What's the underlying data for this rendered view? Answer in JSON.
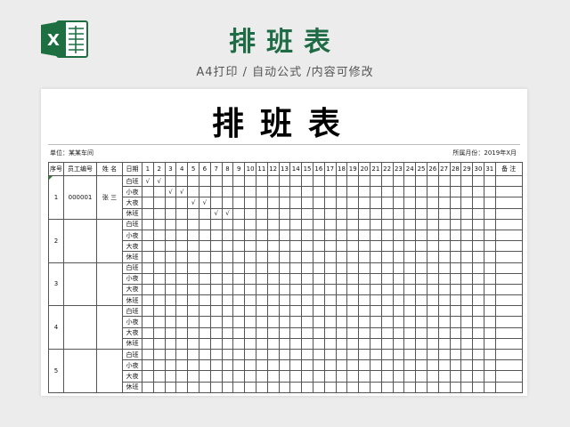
{
  "banner": {
    "title": "排班表",
    "subtitle": "A4打印 / 自动公式 /内容可修改",
    "logo_letter": "X",
    "colors": {
      "excel_green": "#1d6f42",
      "title_green": "#1e6b45"
    }
  },
  "sheet": {
    "title": "排班表",
    "unit_label": "单位：某某车间",
    "month_label": "所属月份：2019年X月",
    "headers": {
      "seq": "序号",
      "emp_id": "员工编号",
      "name": "姓 名",
      "date": "日期",
      "days": [
        "1",
        "2",
        "3",
        "4",
        "5",
        "6",
        "7",
        "8",
        "9",
        "10",
        "11",
        "12",
        "13",
        "14",
        "15",
        "16",
        "17",
        "18",
        "19",
        "20",
        "21",
        "22",
        "23",
        "24",
        "25",
        "26",
        "27",
        "28",
        "29",
        "30",
        "31"
      ],
      "remark": "备 注"
    },
    "shift_types": [
      "白班",
      "小夜",
      "大夜",
      "休班"
    ],
    "check_mark": "√",
    "rows": [
      {
        "seq": "1",
        "emp_id": "000001",
        "name": "张 三",
        "marks": [
          [
            1,
            2
          ],
          [
            3,
            4
          ],
          [
            5,
            6
          ],
          [
            7,
            8
          ]
        ]
      },
      {
        "seq": "2",
        "emp_id": "",
        "name": "",
        "marks": [
          [],
          [],
          [],
          []
        ]
      },
      {
        "seq": "3",
        "emp_id": "",
        "name": "",
        "marks": [
          [],
          [],
          [],
          []
        ]
      },
      {
        "seq": "4",
        "emp_id": "",
        "name": "",
        "marks": [
          [],
          [],
          [],
          []
        ]
      },
      {
        "seq": "5",
        "emp_id": "",
        "name": "",
        "marks": [
          [],
          [],
          [],
          []
        ]
      }
    ]
  }
}
